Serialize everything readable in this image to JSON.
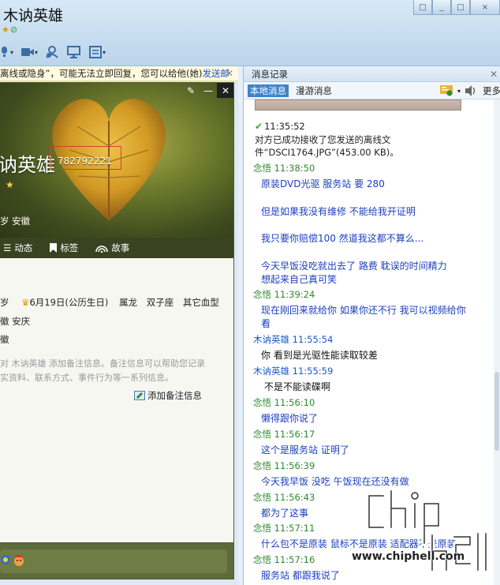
{
  "window": {
    "contact_name": "木讷英雄",
    "controls": [
      "□",
      "_",
      "□",
      "×"
    ]
  },
  "toolbar": {
    "buttons": [
      {
        "icon": "microphone-icon"
      },
      {
        "icon": "video-icon"
      },
      {
        "icon": "add-person-icon"
      },
      {
        "icon": "remote-desktop-icon"
      },
      {
        "icon": "document-icon"
      }
    ]
  },
  "notice": {
    "text": "离线或隐身”，可能无法立即回复，您可以给他(她)",
    "link": "发送邮"
  },
  "profile": {
    "name": "讷英雄",
    "qq_number": "782792221",
    "meta": "岁   安徽",
    "tabs": [
      {
        "label": "动态",
        "icon": "list-icon"
      },
      {
        "label": "标签",
        "icon": "bookmark-icon"
      },
      {
        "label": "故事",
        "icon": "signal-icon"
      }
    ],
    "details": {
      "age": "岁",
      "birthday": "6月19日(公历生日)",
      "zodiac_animal": "属龙",
      "constellation": "双子座",
      "blood_type": "其它血型",
      "location": "徽 安庆",
      "hometown": "徽"
    },
    "tip_line1": "对 木讷英雄 添加备注信息。备注信息可以帮助您记录",
    "tip_line2": "实资料、联系方式、事件行为等一系列信息。",
    "add_note_label": "添加备注信息"
  },
  "history": {
    "title": "消息记录",
    "tab_local": "本地消息",
    "tab_roaming": "漫游消息",
    "more_label": "更多",
    "file_time": "11:35:52",
    "file_notice": "对方已成功接收了您发送的离线文件“DSCI1764.JPG”(453.00 KB)。",
    "messages": [
      {
        "sender": "念悟 11:38:50",
        "self": false,
        "lines": [
          "原装DVD光驱  服务站 要 280"
        ]
      },
      {
        "sender": "",
        "self": false,
        "lines": [
          "但是如果我没有维修 不能给我开证明"
        ]
      },
      {
        "sender": "",
        "self": false,
        "lines": [
          "我只要你赔偿100 然道我这都不算么..."
        ]
      },
      {
        "sender": "",
        "self": false,
        "lines": [
          "今天早饭没吃就出去了  路费 耽误的时间精力",
          "想起来自己真可笑"
        ]
      },
      {
        "sender": "念悟 11:39:24",
        "self": false,
        "lines": [
          "现在刚回来就给你  如果你还不行 我可以视频给你",
          "看"
        ]
      },
      {
        "sender": "木讷英雄 11:55:54",
        "self": true,
        "lines": [
          "你 看到是光驱性能读取较差"
        ]
      },
      {
        "sender": "木讷英雄 11:55:59",
        "self": true,
        "lines": [
          "不是不能读碟啊"
        ]
      },
      {
        "sender": "念悟 11:56:10",
        "self": false,
        "lines": [
          "懒得跟你说了"
        ]
      },
      {
        "sender": "念悟 11:56:17",
        "self": false,
        "lines": [
          "这个是服务站 证明了"
        ]
      },
      {
        "sender": "念悟 11:56:39",
        "self": false,
        "lines": [
          "今天我早饭 没吃  午饭现在还没有做"
        ]
      },
      {
        "sender": "念悟 11:56:43",
        "self": false,
        "lines": [
          "都为了这事"
        ]
      },
      {
        "sender": "念悟 11:57:11",
        "self": false,
        "lines": [
          "什么包不是原装  鼠标不是原装   适配器不是原装"
        ]
      },
      {
        "sender": "念悟 11:57:16",
        "self": false,
        "lines": [
          "服务站 都跟我说了"
        ]
      }
    ]
  },
  "watermark": {
    "logo_text": "chip hell",
    "url": "www.chiphell.com"
  },
  "colors": {
    "accent_blue": "#3f82c9",
    "link_blue": "#1c58c4",
    "sender_green": "#2e8b2e",
    "message_blue": "#1c3fbf"
  }
}
